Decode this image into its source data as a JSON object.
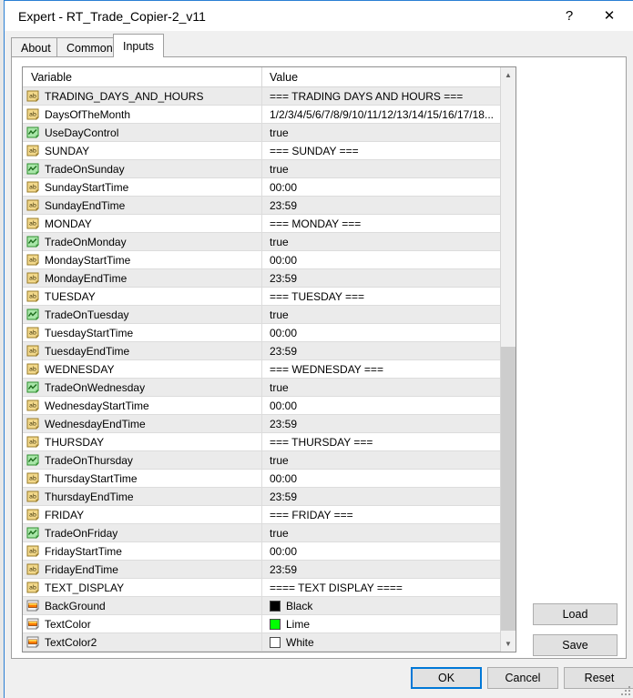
{
  "window": {
    "title": "Expert - RT_Trade_Copier-2_v11",
    "help_glyph": "?",
    "close_glyph": "✕",
    "accent_color": "#2a7fd4"
  },
  "tabs": [
    {
      "label": "About",
      "active": false
    },
    {
      "label": "Common",
      "active": false
    },
    {
      "label": "Inputs",
      "active": true
    }
  ],
  "grid": {
    "columns": [
      "Variable",
      "Value"
    ],
    "rows": [
      {
        "icon": "string-icon",
        "variable": "TRADING_DAYS_AND_HOURS",
        "value": "=== TRADING DAYS AND HOURS ==="
      },
      {
        "icon": "string-icon",
        "variable": "DaysOfTheMonth",
        "value": "1/2/3/4/5/6/7/8/9/10/11/12/13/14/15/16/17/18..."
      },
      {
        "icon": "bool-icon",
        "variable": "UseDayControl",
        "value": "true"
      },
      {
        "icon": "string-icon",
        "variable": "SUNDAY",
        "value": "=== SUNDAY ==="
      },
      {
        "icon": "bool-icon",
        "variable": "TradeOnSunday",
        "value": "true"
      },
      {
        "icon": "string-icon",
        "variable": "SundayStartTime",
        "value": "00:00"
      },
      {
        "icon": "string-icon",
        "variable": "SundayEndTime",
        "value": "23:59"
      },
      {
        "icon": "string-icon",
        "variable": "MONDAY",
        "value": "=== MONDAY ==="
      },
      {
        "icon": "bool-icon",
        "variable": "TradeOnMonday",
        "value": "true"
      },
      {
        "icon": "string-icon",
        "variable": "MondayStartTime",
        "value": "00:00"
      },
      {
        "icon": "string-icon",
        "variable": "MondayEndTime",
        "value": "23:59"
      },
      {
        "icon": "string-icon",
        "variable": "TUESDAY",
        "value": "=== TUESDAY ==="
      },
      {
        "icon": "bool-icon",
        "variable": "TradeOnTuesday",
        "value": "true"
      },
      {
        "icon": "string-icon",
        "variable": "TuesdayStartTime",
        "value": "00:00"
      },
      {
        "icon": "string-icon",
        "variable": "TuesdayEndTime",
        "value": "23:59"
      },
      {
        "icon": "string-icon",
        "variable": "WEDNESDAY",
        "value": "=== WEDNESDAY ==="
      },
      {
        "icon": "bool-icon",
        "variable": "TradeOnWednesday",
        "value": "true"
      },
      {
        "icon": "string-icon",
        "variable": "WednesdayStartTime",
        "value": "00:00"
      },
      {
        "icon": "string-icon",
        "variable": "WednesdayEndTime",
        "value": "23:59"
      },
      {
        "icon": "string-icon",
        "variable": "THURSDAY",
        "value": "=== THURSDAY ==="
      },
      {
        "icon": "bool-icon",
        "variable": "TradeOnThursday",
        "value": "true"
      },
      {
        "icon": "string-icon",
        "variable": "ThursdayStartTime",
        "value": "00:00"
      },
      {
        "icon": "string-icon",
        "variable": "ThursdayEndTime",
        "value": "23:59"
      },
      {
        "icon": "string-icon",
        "variable": "FRIDAY",
        "value": "=== FRIDAY ==="
      },
      {
        "icon": "bool-icon",
        "variable": "TradeOnFriday",
        "value": "true"
      },
      {
        "icon": "string-icon",
        "variable": "FridayStartTime",
        "value": "00:00"
      },
      {
        "icon": "string-icon",
        "variable": "FridayEndTime",
        "value": "23:59"
      },
      {
        "icon": "string-icon",
        "variable": "TEXT_DISPLAY",
        "value": "==== TEXT DISPLAY ===="
      },
      {
        "icon": "color-icon",
        "variable": "BackGround",
        "value": "Black",
        "swatch": "#000000"
      },
      {
        "icon": "color-icon",
        "variable": "TextColor",
        "value": "Lime",
        "swatch": "#00ff00"
      },
      {
        "icon": "color-icon",
        "variable": "TextColor2",
        "value": "White",
        "swatch": "#ffffff"
      }
    ]
  },
  "scrollbar": {
    "up_arrow": "▲",
    "down_arrow": "▼"
  },
  "side_buttons": [
    {
      "label": "Load"
    },
    {
      "label": "Save"
    }
  ],
  "footer_buttons": [
    {
      "label": "OK",
      "default": true
    },
    {
      "label": "Cancel",
      "default": false
    },
    {
      "label": "Reset",
      "default": false
    }
  ]
}
